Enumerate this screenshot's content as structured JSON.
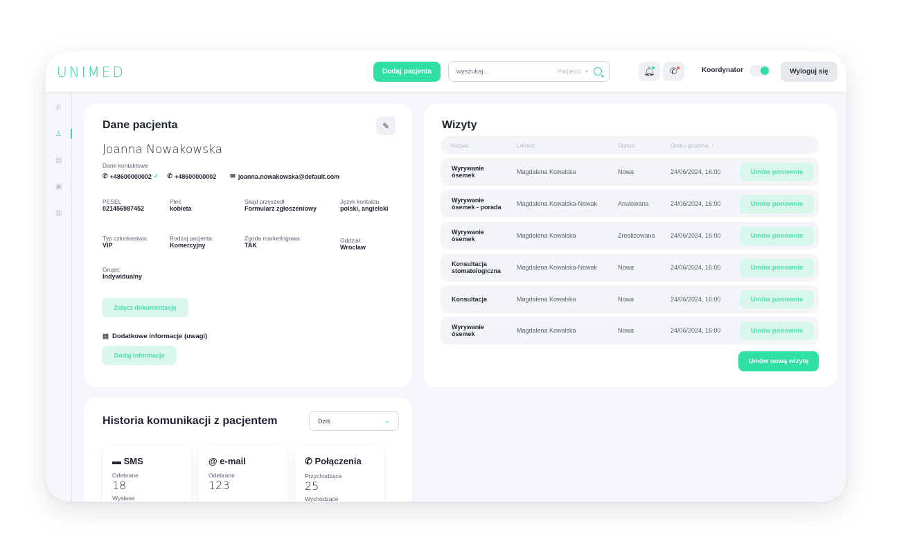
{
  "app": {
    "logo": "UNIMED"
  },
  "header": {
    "add_patient_label": "Dodaj pacjenta",
    "search_placeholder": "wyszukaj...",
    "search_scope": "Pacjenci",
    "coordinator_label": "Koordynator",
    "coordinator_on": true,
    "logout_label": "Wyloguj się"
  },
  "patient": {
    "title": "Dane pacjenta",
    "name": "Joanna Nowakowska",
    "contact_label": "Dane kontaktowe",
    "phone1": "+48600000002",
    "phone2": "+48600000002",
    "email": "joanna.nowakowska@default.com",
    "fields": [
      {
        "label": "PESEL",
        "value": "021456987452"
      },
      {
        "label": "Płeć",
        "value": "kobieta"
      },
      {
        "label": "Skąd przyszedł",
        "value": "Formularz zgłoszeniowy"
      },
      {
        "label": "Język kontaktu",
        "value": "polski, angielski"
      },
      {
        "label": "Typ członkostwa:",
        "value": "VIP"
      },
      {
        "label": "Rodzaj pacjenta:",
        "value": "Komercyjny"
      },
      {
        "label": "Zgoda marketingowa:",
        "value": "TAK"
      },
      {
        "label": "Oddział:",
        "value": "Wrocław"
      },
      {
        "label": "Grupa:",
        "value": "Indywidualny"
      }
    ],
    "attach_docs_label": "Załącz dokumentację",
    "notes_label": "Dodatkowe informacje (uwagi)",
    "add_info_label": "Dodaj informacje"
  },
  "visits": {
    "title": "Wizyty",
    "columns": [
      "Nazwa:",
      "Lekarz:",
      "Status:",
      "Data i godzina: ↕"
    ],
    "rows": [
      {
        "name": "Wyrywanie ósemek",
        "doctor": "Magdalena Kowalska",
        "status": "Nowa",
        "datetime": "24/06/2024, 16:00",
        "action": "Umów ponownie"
      },
      {
        "name": "Wyrywanie ósemek - porada",
        "doctor": "Magdalena Kowalska-Nowak",
        "status": "Anulowana",
        "datetime": "24/06/2024, 16:00",
        "action": "Umów ponownie"
      },
      {
        "name": "Wyrywanie ósemek",
        "doctor": "Magdalena Kowalska",
        "status": "Zrealizowana",
        "datetime": "24/06/2024, 16:00",
        "action": "Umów ponownie"
      },
      {
        "name": "Konsultacja stomatologiczna",
        "doctor": "Magdalena Kowalska-Nowak",
        "status": "Nowa",
        "datetime": "24/06/2024, 16:00",
        "action": "Umów ponownie"
      },
      {
        "name": "Konsultacja",
        "doctor": "Magdalena Kowalska",
        "status": "Nowa",
        "datetime": "24/06/2024, 16:00",
        "action": "Umów ponownie"
      },
      {
        "name": "Wyrywanie ósemek",
        "doctor": "Magdalena Kowalska",
        "status": "Nowa",
        "datetime": "24/06/2024, 16:00",
        "action": "Umów ponownie"
      }
    ],
    "new_visit_label": "Umów nową wizytę"
  },
  "history": {
    "title": "Historia komunikacji z pacjentem",
    "period": "Dziś",
    "sms": {
      "title": "SMS",
      "l1": "Odebrane",
      "v1": "18",
      "l2": "Wysłane"
    },
    "email": {
      "title": "e-mail",
      "l1": "Odebrane",
      "v1": "123"
    },
    "calls": {
      "title": "Połączenia",
      "l1": "Przychodzące",
      "v1": "25",
      "l2": "Wychodzące"
    }
  },
  "colors": {
    "accent": "#2ee0a6",
    "accent_pale": "#d8f7ea",
    "background": "#f4f6f9"
  }
}
